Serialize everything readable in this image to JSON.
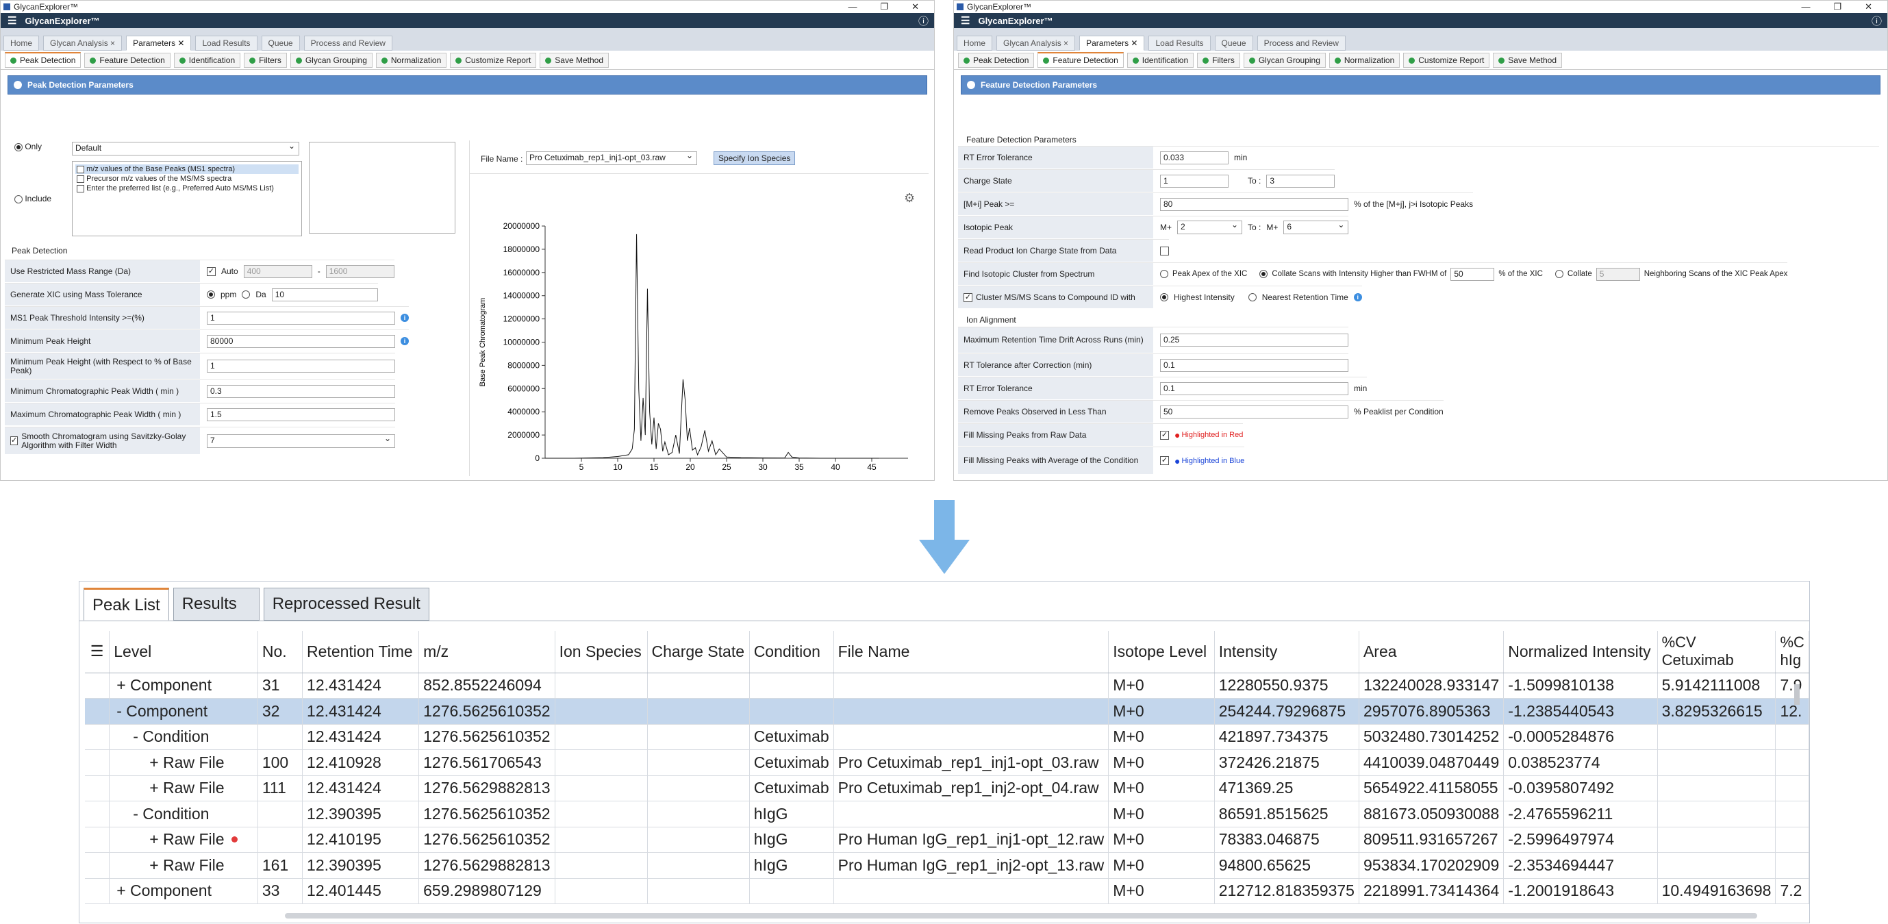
{
  "window1": {
    "title": "GlycanExplorer™",
    "app_name": "GlycanExplorer™",
    "tabs": [
      "Home",
      "Glycan Analysis",
      "Parameters",
      "Load Results",
      "Queue",
      "Process and Review"
    ],
    "subtabs": [
      "Peak Detection",
      "Feature Detection",
      "Identification",
      "Filters",
      "Glycan Grouping",
      "Normalization",
      "Customize Report",
      "Save Method"
    ],
    "panel_title": "Peak Detection Parameters",
    "only_label": "Only",
    "only_value": "Default",
    "include_label": "Include",
    "list_items": [
      "m/z values of the Base Peaks (MS1 spectra)",
      "Precursor m/z values of the MS/MS spectra",
      "Enter the preferred list (e.g., Preferred Auto MS/MS List)"
    ],
    "file_name_label": "File Name :",
    "file_name_value": "Pro Cetuximab_rep1_inj1-opt_03.raw",
    "specify_button": "Specify Ion Species",
    "section_peak_detection": "Peak Detection",
    "rows": {
      "restricted_mass": "Use Restricted Mass Range (Da)",
      "auto": "Auto",
      "mass_from": "400",
      "mass_dash": "-",
      "mass_to": "1600",
      "xic_tolerance": "Generate XIC using Mass Tolerance",
      "ppm": "ppm",
      "da": "Da",
      "tol_value": "10",
      "ms1_threshold": "MS1 Peak Threshold Intensity >=(%)",
      "ms1_value": "1",
      "min_peak_height": "Minimum Peak Height",
      "min_peak_value": "80000",
      "min_peak_height_pct": "Minimum Peak Height (with Respect to % of Base Peak)",
      "min_peak_pct_value": "1",
      "min_width": "Minimum Chromatographic Peak Width ( min )",
      "min_width_value": "0.3",
      "max_width": "Maximum Chromatographic Peak Width ( min )",
      "max_width_value": "1.5",
      "smooth": "Smooth Chromatogram using Savitzky-Golay Algorithm with Filter Width",
      "smooth_value": "7"
    }
  },
  "chart_data": {
    "type": "line",
    "ylabel": "Base Peak Chromatogram",
    "xlabel": "",
    "xlim": [
      0,
      50
    ],
    "ylim": [
      0,
      20000000
    ],
    "xticks": [
      5,
      10,
      15,
      20,
      25,
      30,
      35,
      40,
      45
    ],
    "yticks": [
      0,
      2000000,
      4000000,
      6000000,
      8000000,
      10000000,
      12000000,
      14000000,
      16000000,
      18000000,
      20000000
    ],
    "ytick_labels": [
      "0",
      "2000000",
      "4000000",
      "6000000",
      "8000000",
      "10000000",
      "12000000",
      "14000000",
      "16000000",
      "18000000",
      "20000000"
    ],
    "series": [
      {
        "x": [
          0,
          4,
          8,
          10,
          11.5,
          12,
          12.3,
          12.6,
          12.9,
          13.2,
          13.5,
          13.8,
          14.1,
          14.4,
          14.7,
          15,
          15.3,
          15.6,
          15.9,
          16.2,
          16.5,
          17,
          17.5,
          18,
          18.5,
          19,
          19.3,
          19.6,
          19.9,
          20.3,
          20.7,
          21,
          21.5,
          22,
          22.5,
          23,
          23.5,
          24,
          25,
          27,
          30,
          33,
          33.5,
          34,
          35,
          38,
          42,
          46
        ],
        "y": [
          0,
          0,
          50000,
          150000,
          300000,
          800000,
          2500000,
          19300000,
          6000000,
          1500000,
          5200000,
          2000000,
          14600000,
          4000000,
          1200000,
          3500000,
          800000,
          3000000,
          2500000,
          600000,
          1400000,
          300000,
          500000,
          2000000,
          400000,
          6800000,
          5000000,
          1500000,
          2600000,
          700000,
          900000,
          300000,
          1000000,
          2400000,
          600000,
          1500000,
          300000,
          800000,
          100000,
          50000,
          30000,
          20000,
          500000,
          100000,
          20000,
          0,
          0,
          0
        ]
      }
    ]
  },
  "window2": {
    "title": "GlycanExplorer™",
    "app_name": "GlycanExplorer™",
    "panel_title": "Feature Detection Parameters",
    "section_feature": "Feature Detection Parameters",
    "rt_error": "RT Error Tolerance",
    "rt_error_value": "0.033",
    "rt_error_unit": "min",
    "charge_state": "Charge State",
    "charge_from": "1",
    "charge_to_label": "To :",
    "charge_to": "3",
    "mi_peak": "[M+i] Peak >=",
    "mi_peak_value": "80",
    "mi_peak_unit": "% of the [M+j], j>i Isotopic Peaks",
    "isotopic_peak": "Isotopic Peak",
    "iso_from_prefix": "M+",
    "iso_from": "2",
    "iso_to_label": "To :",
    "iso_to_prefix": "M+",
    "iso_to": "6",
    "read_product": "Read Product Ion Charge State from Data",
    "find_isotopic": "Find Isotopic Cluster from Spectrum",
    "peak_apex": "Peak Apex of the XIC",
    "collate_scans": "Collate Scans with Intensity Higher than FWHM of",
    "collate_pct": "50",
    "collate_pct_unit": "% of the XIC",
    "collate": "Collate",
    "collate_n": "5",
    "neighboring": "Neighboring Scans of the XIC Peak Apex",
    "cluster_msms": "Cluster MS/MS Scans to Compound ID with",
    "highest_intensity": "Highest Intensity",
    "nearest_rt": "Nearest Retention Time",
    "section_ion": "Ion Alignment",
    "max_rt_drift": "Maximum Retention Time Drift Across Runs (min)",
    "max_rt_drift_value": "0.25",
    "rt_after": "RT Tolerance after Correction (min)",
    "rt_after_value": "0.1",
    "rt_error2": "RT Error Tolerance",
    "rt_error2_value": "0.1",
    "rt_error2_unit": "min",
    "remove_peaks": "Remove Peaks Observed in Less Than",
    "remove_value": "50",
    "remove_unit": "% Peaklist per Condition",
    "fill_missing": "Fill Missing Peaks from Raw Data",
    "highlighted_red": "Highlighted in Red",
    "fill_avg": "Fill Missing Peaks with Average of the Condition",
    "highlighted_blue": "Highlighted in Blue"
  },
  "grid": {
    "tabs": [
      "Peak List",
      "Results",
      "Reprocessed Result"
    ],
    "columns": [
      "Level",
      "No.",
      "Retention Time",
      "m/z",
      "Ion Species",
      "Charge State",
      "Condition",
      "File Name",
      "Isotope Level",
      "Intensity",
      "Area",
      "Normalized Intensity",
      "%CV Cetuximab",
      "%C hIg"
    ],
    "rows": [
      {
        "lvl": "+  Component",
        "no": "31",
        "rt": "12.431424",
        "mz": "852.8552246094",
        "ion": "",
        "cs": "",
        "cond": "",
        "file": "",
        "iso": "M+0",
        "int": "12280550.9375",
        "area": "132240028.933147",
        "norm": "-1.5099810138",
        "cv1": "5.9142111008",
        "cv2": "7.9"
      },
      {
        "lvl": "-  Component",
        "no": "32",
        "rt": "12.431424",
        "mz": "1276.5625610352",
        "ion": "",
        "cs": "",
        "cond": "",
        "file": "",
        "iso": "M+0",
        "int": "254244.79296875",
        "area": "2957076.8905363",
        "norm": "-1.2385440543",
        "cv1": "3.8295326615",
        "cv2": "12."
      },
      {
        "lvl": "-  Condition",
        "no": "",
        "rt": "12.431424",
        "mz": "1276.5625610352",
        "ion": "",
        "cs": "",
        "cond": "Cetuximab",
        "file": "",
        "iso": "M+0",
        "int": "421897.734375",
        "area": "5032480.73014252",
        "norm": "-0.0005284876",
        "cv1": "",
        "cv2": ""
      },
      {
        "lvl": "+  Raw File",
        "no": "100",
        "rt": "12.410928",
        "mz": "1276.561706543",
        "ion": "",
        "cs": "",
        "cond": "Cetuximab",
        "file": "Pro Cetuximab_rep1_inj1-opt_03.raw",
        "iso": "M+0",
        "int": "372426.21875",
        "area": "4410039.04870449",
        "norm": "0.038523774",
        "cv1": "",
        "cv2": ""
      },
      {
        "lvl": "+  Raw File",
        "no": "111",
        "rt": "12.431424",
        "mz": "1276.5629882813",
        "ion": "",
        "cs": "",
        "cond": "Cetuximab",
        "file": "Pro Cetuximab_rep1_inj2-opt_04.raw",
        "iso": "M+0",
        "int": "471369.25",
        "area": "5654922.41158055",
        "norm": "-0.0395807492",
        "cv1": "",
        "cv2": ""
      },
      {
        "lvl": "-  Condition",
        "no": "",
        "rt": "12.390395",
        "mz": "1276.5625610352",
        "ion": "",
        "cs": "",
        "cond": "hIgG",
        "file": "",
        "iso": "M+0",
        "int": "86591.8515625",
        "area": "881673.050930088",
        "norm": "-2.4765596211",
        "cv1": "",
        "cv2": ""
      },
      {
        "lvl": "+  Raw File",
        "no": "",
        "rt": "12.410195",
        "mz": "1276.5625610352",
        "ion": "",
        "cs": "",
        "cond": "hIgG",
        "file": "Pro Human IgG_rep1_inj1-opt_12.raw",
        "iso": "M+0",
        "int": "78383.046875",
        "area": "809511.931657267",
        "norm": "-2.5996497974",
        "cv1": "",
        "cv2": ""
      },
      {
        "lvl": "+  Raw File",
        "no": "161",
        "rt": "12.390395",
        "mz": "1276.5629882813",
        "ion": "",
        "cs": "",
        "cond": "hIgG",
        "file": "Pro Human IgG_rep1_inj2-opt_13.raw",
        "iso": "M+0",
        "int": "94800.65625",
        "area": "953834.170202909",
        "norm": "-2.3534694447",
        "cv1": "",
        "cv2": ""
      },
      {
        "lvl": "+  Component",
        "no": "33",
        "rt": "12.401445",
        "mz": "659.2989807129",
        "ion": "",
        "cs": "",
        "cond": "",
        "file": "",
        "iso": "M+0",
        "int": "212712.818359375",
        "area": "2218991.73414364",
        "norm": "-1.2001918643",
        "cv1": "10.4949163698",
        "cv2": "7.2"
      }
    ]
  }
}
